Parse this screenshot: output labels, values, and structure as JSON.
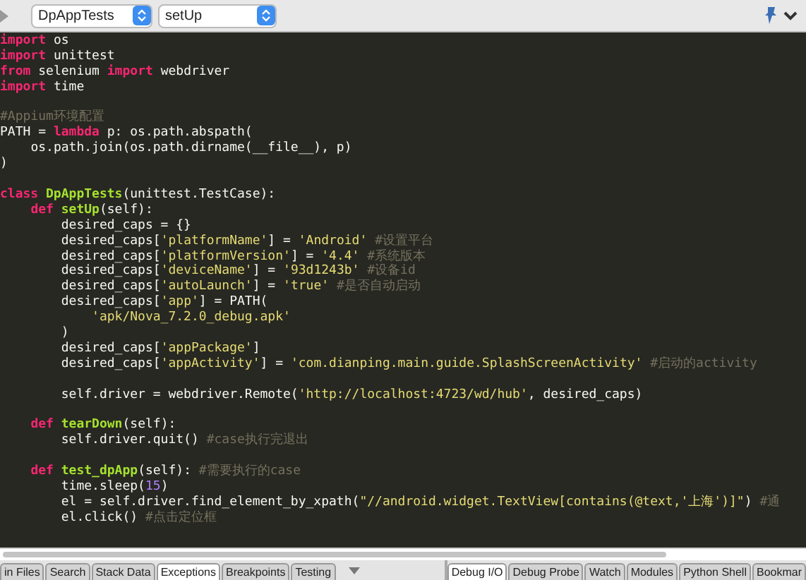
{
  "toolbar": {
    "class_select": "DpAppTests",
    "method_select": "setUp"
  },
  "code": [
    {
      "tokens": [
        {
          "kind": "kw",
          "text": "import"
        },
        {
          "kind": "plain",
          "text": " os"
        }
      ]
    },
    {
      "tokens": [
        {
          "kind": "kw",
          "text": "import"
        },
        {
          "kind": "plain",
          "text": " unittest"
        }
      ]
    },
    {
      "tokens": [
        {
          "kind": "kw",
          "text": "from"
        },
        {
          "kind": "plain",
          "text": " selenium"
        },
        {
          "kind": "kw",
          "text": " import"
        },
        {
          "kind": "plain",
          "text": " webdriver"
        }
      ]
    },
    {
      "tokens": [
        {
          "kind": "kw",
          "text": "import"
        },
        {
          "kind": "plain",
          "text": " time"
        }
      ]
    },
    {
      "space_before": true,
      "tokens": [
        {
          "kind": "comment",
          "text": "#Appium环境配置"
        }
      ]
    },
    {
      "tokens": [
        {
          "kind": "plain",
          "text": "PATH = "
        },
        {
          "kind": "kw",
          "text": "lambda"
        },
        {
          "kind": "plain",
          "text": " p: os.path.abspath("
        }
      ]
    },
    {
      "tokens": [
        {
          "kind": "plain",
          "text": "    os.path.join(os.path.dirname(__file__), p)"
        }
      ]
    },
    {
      "tokens": [
        {
          "kind": "plain",
          "text": ")"
        }
      ]
    },
    {
      "space_before": true,
      "tokens": [
        {
          "kind": "kw",
          "text": "class"
        },
        {
          "kind": "name",
          "text": " DpAppTests"
        },
        {
          "kind": "plain",
          "text": "(unittest.TestCase):"
        }
      ]
    },
    {
      "tokens": [
        {
          "kind": "kw",
          "text": "    def"
        },
        {
          "kind": "name",
          "text": " setUp"
        },
        {
          "kind": "plain",
          "text": "(self):"
        }
      ]
    },
    {
      "tokens": [
        {
          "kind": "plain",
          "text": "        desired_caps = {}"
        }
      ]
    },
    {
      "tokens": [
        {
          "kind": "plain",
          "text": "        desired_caps["
        },
        {
          "kind": "str",
          "text": "'platformName'"
        },
        {
          "kind": "plain",
          "text": "] = "
        },
        {
          "kind": "str",
          "text": "'Android'"
        },
        {
          "kind": "comment",
          "text": " #设置平台"
        }
      ]
    },
    {
      "tokens": [
        {
          "kind": "plain",
          "text": "        desired_caps["
        },
        {
          "kind": "str",
          "text": "'platformVersion'"
        },
        {
          "kind": "plain",
          "text": "] = "
        },
        {
          "kind": "str",
          "text": "'4.4'"
        },
        {
          "kind": "comment",
          "text": " #系统版本"
        }
      ]
    },
    {
      "tokens": [
        {
          "kind": "plain",
          "text": "        desired_caps["
        },
        {
          "kind": "str",
          "text": "'deviceName'"
        },
        {
          "kind": "plain",
          "text": "] = "
        },
        {
          "kind": "str",
          "text": "'93d1243b'"
        },
        {
          "kind": "comment",
          "text": " #设备id"
        }
      ]
    },
    {
      "tokens": [
        {
          "kind": "plain",
          "text": "        desired_caps["
        },
        {
          "kind": "str",
          "text": "'autoLaunch'"
        },
        {
          "kind": "plain",
          "text": "] = "
        },
        {
          "kind": "str",
          "text": "'true'"
        },
        {
          "kind": "comment",
          "text": " #是否自动启动"
        }
      ]
    },
    {
      "tokens": [
        {
          "kind": "plain",
          "text": "        desired_caps["
        },
        {
          "kind": "str",
          "text": "'app'"
        },
        {
          "kind": "plain",
          "text": "] = PATH("
        }
      ]
    },
    {
      "tokens": [
        {
          "kind": "str",
          "text": "            'apk/Nova_7.2.0_debug.apk'"
        }
      ]
    },
    {
      "tokens": [
        {
          "kind": "plain",
          "text": "        )"
        }
      ]
    },
    {
      "tokens": [
        {
          "kind": "plain",
          "text": "        desired_caps["
        },
        {
          "kind": "str",
          "text": "'appPackage'"
        },
        {
          "kind": "plain",
          "text": "]"
        }
      ]
    },
    {
      "tokens": [
        {
          "kind": "plain",
          "text": "        desired_caps["
        },
        {
          "kind": "str",
          "text": "'appActivity'"
        },
        {
          "kind": "plain",
          "text": "] = "
        },
        {
          "kind": "str",
          "text": "'com.dianping.main.guide.SplashScreenActivity'"
        },
        {
          "kind": "comment",
          "text": " #启动的activity"
        }
      ]
    },
    {
      "space_before": true,
      "tokens": [
        {
          "kind": "plain",
          "text": "        self.driver = webdriver.Remote("
        },
        {
          "kind": "str",
          "text": "'http://localhost:4723/wd/hub'"
        },
        {
          "kind": "plain",
          "text": ", desired_caps)"
        }
      ]
    },
    {
      "space_before": true,
      "tokens": [
        {
          "kind": "kw",
          "text": "    def"
        },
        {
          "kind": "name",
          "text": " tearDown"
        },
        {
          "kind": "plain",
          "text": "(self):"
        }
      ]
    },
    {
      "tokens": [
        {
          "kind": "plain",
          "text": "        self.driver.quit()"
        },
        {
          "kind": "comment",
          "text": " #case执行完退出"
        }
      ]
    },
    {
      "space_before": true,
      "tokens": [
        {
          "kind": "kw",
          "text": "    def"
        },
        {
          "kind": "name",
          "text": " test_dpApp"
        },
        {
          "kind": "plain",
          "text": "(self):"
        },
        {
          "kind": "comment",
          "text": " #需要执行的case"
        }
      ]
    },
    {
      "tokens": [
        {
          "kind": "plain",
          "text": "        time.sleep("
        },
        {
          "kind": "num",
          "text": "15"
        },
        {
          "kind": "plain",
          "text": ")"
        }
      ]
    },
    {
      "tokens": [
        {
          "kind": "plain",
          "text": "        el = self.driver.find_element_by_xpath("
        },
        {
          "kind": "str",
          "text": "\"//android.widget.TextView[contains(@text,'上海')]\""
        },
        {
          "kind": "plain",
          "text": ")"
        },
        {
          "kind": "comment",
          "text": " #通"
        }
      ]
    },
    {
      "tokens": [
        {
          "kind": "plain",
          "text": "        el.click()"
        },
        {
          "kind": "comment",
          "text": " #点击定位框"
        }
      ]
    }
  ],
  "left_tabs": [
    {
      "label": "in Files",
      "selected": false
    },
    {
      "label": "Search",
      "selected": false
    },
    {
      "label": "Stack Data",
      "selected": false
    },
    {
      "label": "Exceptions",
      "selected": true
    },
    {
      "label": "Breakpoints",
      "selected": false
    },
    {
      "label": "Testing",
      "selected": false
    }
  ],
  "right_tabs": [
    {
      "label": "Debug I/O",
      "selected": true
    },
    {
      "label": "Debug Probe",
      "selected": false
    },
    {
      "label": "Watch",
      "selected": false
    },
    {
      "label": "Modules",
      "selected": false
    },
    {
      "label": "Python Shell",
      "selected": false
    },
    {
      "label": "Bookmar",
      "selected": false
    }
  ]
}
